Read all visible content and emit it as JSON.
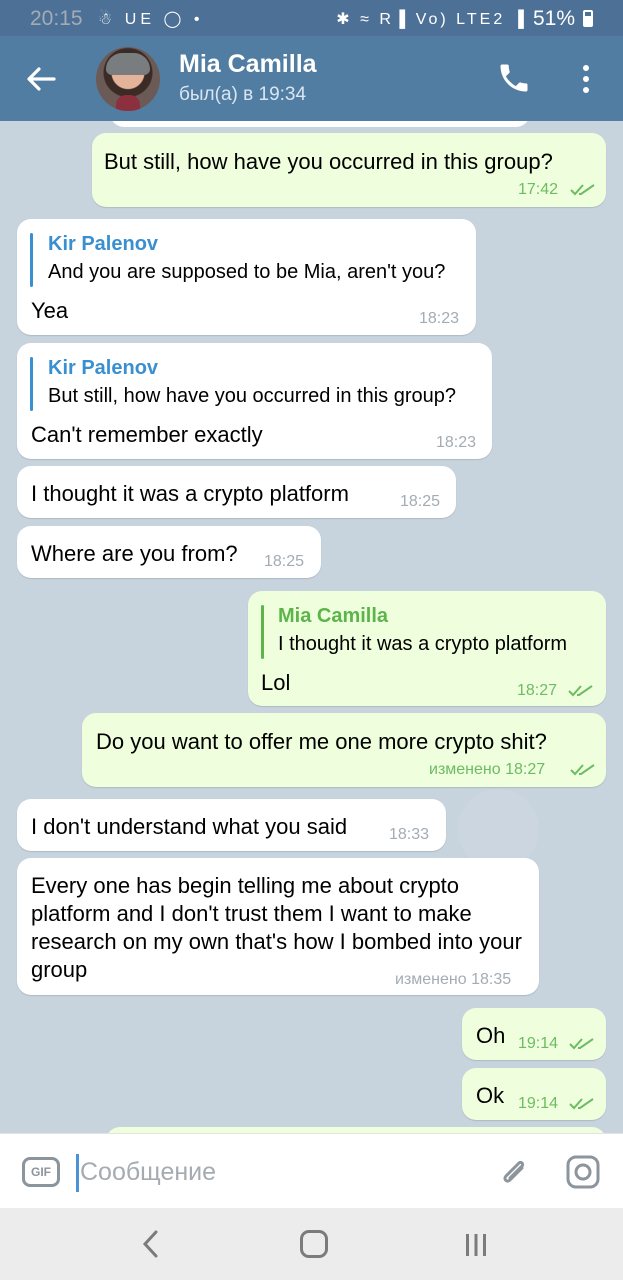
{
  "status_bar": {
    "time": "20:15",
    "left_icons": "☃ UE ◯ •",
    "right_icons": "✱ ≈ R▐ Vo) LTE2 ▐",
    "battery": "51%"
  },
  "header": {
    "contact_name": "Mia Camilla",
    "last_seen": "был(а) в 19:34"
  },
  "messages": [
    {
      "side": "out",
      "text": "But still, how have you occurred in this group?",
      "time": "17:42"
    },
    {
      "side": "in",
      "reply_to": "Kir Palenov",
      "quote": "And you are supposed to be Mia, aren't you?",
      "text": "Yea",
      "time": "18:23"
    },
    {
      "side": "in",
      "reply_to": "Kir Palenov",
      "quote": "But still, how have you occurred in this group?",
      "text": "Can't remember exactly",
      "time": "18:23"
    },
    {
      "side": "in",
      "text": "I thought it was a crypto platform",
      "time": "18:25"
    },
    {
      "side": "in",
      "text": "Where are you from?",
      "time": "18:25"
    },
    {
      "side": "out",
      "reply_to": "Mia Camilla",
      "quote": "I thought it was a crypto platform",
      "text": "Lol",
      "time": "18:27"
    },
    {
      "side": "out",
      "text": "Do you want to offer me one more crypto shit?",
      "time": "изменено 18:27"
    },
    {
      "side": "in",
      "text": "I don't understand what you said",
      "time": "18:33"
    },
    {
      "side": "in",
      "text": "Every one has begin telling me about crypto platform and I don't trust them I want to make research on my own that's how I bombed into your group",
      "time": "изменено 18:35"
    },
    {
      "side": "out",
      "text": "Oh",
      "time": "19:14"
    },
    {
      "side": "out",
      "text": "Ok",
      "time": "19:14"
    }
  ],
  "input": {
    "gif_label": "GIF",
    "placeholder": "Сообщение"
  },
  "icons": {
    "back": "arrow-left",
    "call": "phone",
    "menu": "more-vertical",
    "attach": "paperclip",
    "camera": "instagram-camera",
    "nav_back": "chevron-left",
    "nav_home": "rounded-square",
    "nav_recent": "three-bars"
  },
  "colors": {
    "header": "#517da2",
    "status_bar": "#4d7196",
    "incoming_bubble": "#ffffff",
    "outgoing_bubble": "#effedd",
    "reply_incoming": "#3a8fd0",
    "reply_outgoing": "#5cb54a",
    "chat_background": "#c7d3dd"
  }
}
